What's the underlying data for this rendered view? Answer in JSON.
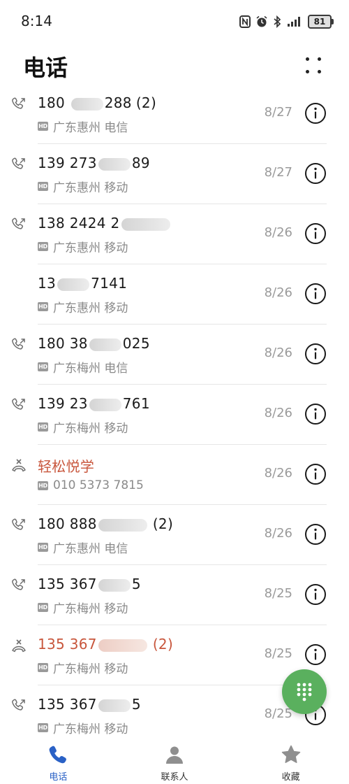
{
  "status_bar": {
    "time": "8:14",
    "battery": "81"
  },
  "header": {
    "title": "电话"
  },
  "calls": [
    {
      "type": "outgoing",
      "number_prefix": "180 ",
      "number_suffix": "288",
      "count": "(2)",
      "location": "广东惠州 电信",
      "date": "8/27",
      "missed": false
    },
    {
      "type": "outgoing",
      "number_prefix": "139 273",
      "number_suffix": "89",
      "count": "",
      "location": "广东惠州 移动",
      "date": "8/27",
      "missed": false
    },
    {
      "type": "outgoing",
      "number_prefix": "138 2424 2",
      "number_suffix": "",
      "count": "",
      "location": "广东惠州 移动",
      "date": "8/26",
      "missed": false
    },
    {
      "type": "none",
      "number_prefix": "13",
      "number_suffix": "7141",
      "count": "",
      "location": "广东惠州 移动",
      "date": "8/26",
      "missed": false
    },
    {
      "type": "outgoing",
      "number_prefix": "180 38",
      "number_suffix": "025",
      "count": "",
      "location": "广东梅州 电信",
      "date": "8/26",
      "missed": false
    },
    {
      "type": "outgoing",
      "number_prefix": "139 23",
      "number_suffix": "761",
      "count": "",
      "location": "广东梅州 移动",
      "date": "8/26",
      "missed": false
    },
    {
      "type": "missed",
      "number_prefix": "轻松悦学",
      "number_suffix": "",
      "count": "",
      "location": "010 5373 7815",
      "date": "8/26",
      "missed": true
    },
    {
      "type": "outgoing",
      "number_prefix": "180 888",
      "number_suffix": "",
      "count": "(2)",
      "location": "广东惠州 电信",
      "date": "8/26",
      "missed": false
    },
    {
      "type": "outgoing",
      "number_prefix": "135 367",
      "number_suffix": "5",
      "count": "",
      "location": "广东梅州 移动",
      "date": "8/25",
      "missed": false
    },
    {
      "type": "missed",
      "number_prefix": "135 367",
      "number_suffix": "",
      "count": "(2)",
      "location": "广东梅州 移动",
      "date": "8/25",
      "missed": true
    },
    {
      "type": "outgoing",
      "number_prefix": "135 367",
      "number_suffix": "5",
      "count": "",
      "location": "广东梅州 移动",
      "date": "8/25",
      "missed": false
    }
  ],
  "bottom_nav": {
    "phone": "电话",
    "contacts": "联系人",
    "favorites": "收藏"
  },
  "colors": {
    "accent_blue": "#2a61c6",
    "missed_red": "#c8563c",
    "fab_green": "#5ab05e"
  }
}
